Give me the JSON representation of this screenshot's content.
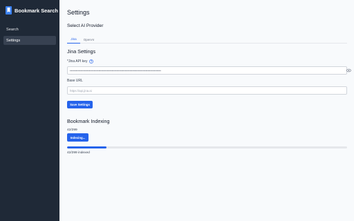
{
  "sidebar": {
    "brand": {
      "title": "Bookmark Search",
      "icon": "bookmark-icon"
    },
    "items": [
      {
        "label": "Search",
        "active": false
      },
      {
        "label": "Settings",
        "active": true
      }
    ]
  },
  "main": {
    "page_title": "Settings",
    "provider_section": {
      "title": "Select AI Provider",
      "tabs": [
        {
          "label": "Jina",
          "active": true
        },
        {
          "label": "OpenAI",
          "active": false
        }
      ]
    },
    "jina_settings": {
      "title": "Jina Settings",
      "api_key": {
        "label": "*Jina API key",
        "value": "••••••••••••••••••••••••••••••••••••••••••••••••••••••••••••••••••••••••••••",
        "help_icon": "question-circle-icon",
        "toggle_icon": "eye-icon"
      },
      "base_url": {
        "label": "Base URL",
        "placeholder": "https://api.jina.ai"
      },
      "save_label": "Save Settings"
    },
    "indexing": {
      "title": "Bookmark Indexing",
      "count_text": "42/299",
      "button_label": "Indexing...",
      "progress": {
        "done": 42,
        "total": 299
      },
      "status_text": "42/299 indexed"
    }
  },
  "colors": {
    "sidebar_bg": "#1f2937",
    "accent": "#2563eb",
    "page_bg": "#f8fafc"
  }
}
